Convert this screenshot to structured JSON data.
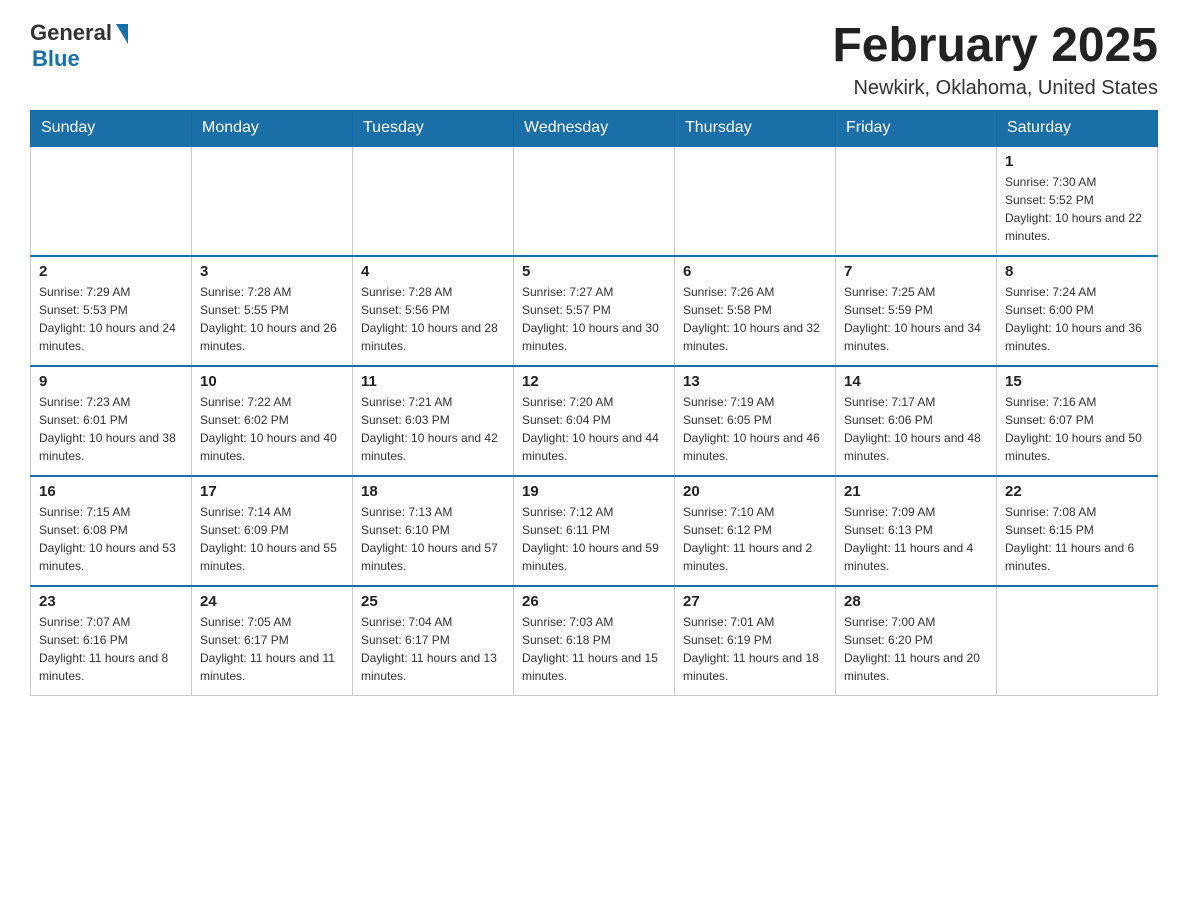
{
  "header": {
    "logo_general": "General",
    "logo_blue": "Blue",
    "title": "February 2025",
    "location": "Newkirk, Oklahoma, United States"
  },
  "weekdays": [
    "Sunday",
    "Monday",
    "Tuesday",
    "Wednesday",
    "Thursday",
    "Friday",
    "Saturday"
  ],
  "weeks": [
    [
      {
        "day": "",
        "sunrise": "",
        "sunset": "",
        "daylight": ""
      },
      {
        "day": "",
        "sunrise": "",
        "sunset": "",
        "daylight": ""
      },
      {
        "day": "",
        "sunrise": "",
        "sunset": "",
        "daylight": ""
      },
      {
        "day": "",
        "sunrise": "",
        "sunset": "",
        "daylight": ""
      },
      {
        "day": "",
        "sunrise": "",
        "sunset": "",
        "daylight": ""
      },
      {
        "day": "",
        "sunrise": "",
        "sunset": "",
        "daylight": ""
      },
      {
        "day": "1",
        "sunrise": "Sunrise: 7:30 AM",
        "sunset": "Sunset: 5:52 PM",
        "daylight": "Daylight: 10 hours and 22 minutes."
      }
    ],
    [
      {
        "day": "2",
        "sunrise": "Sunrise: 7:29 AM",
        "sunset": "Sunset: 5:53 PM",
        "daylight": "Daylight: 10 hours and 24 minutes."
      },
      {
        "day": "3",
        "sunrise": "Sunrise: 7:28 AM",
        "sunset": "Sunset: 5:55 PM",
        "daylight": "Daylight: 10 hours and 26 minutes."
      },
      {
        "day": "4",
        "sunrise": "Sunrise: 7:28 AM",
        "sunset": "Sunset: 5:56 PM",
        "daylight": "Daylight: 10 hours and 28 minutes."
      },
      {
        "day": "5",
        "sunrise": "Sunrise: 7:27 AM",
        "sunset": "Sunset: 5:57 PM",
        "daylight": "Daylight: 10 hours and 30 minutes."
      },
      {
        "day": "6",
        "sunrise": "Sunrise: 7:26 AM",
        "sunset": "Sunset: 5:58 PM",
        "daylight": "Daylight: 10 hours and 32 minutes."
      },
      {
        "day": "7",
        "sunrise": "Sunrise: 7:25 AM",
        "sunset": "Sunset: 5:59 PM",
        "daylight": "Daylight: 10 hours and 34 minutes."
      },
      {
        "day": "8",
        "sunrise": "Sunrise: 7:24 AM",
        "sunset": "Sunset: 6:00 PM",
        "daylight": "Daylight: 10 hours and 36 minutes."
      }
    ],
    [
      {
        "day": "9",
        "sunrise": "Sunrise: 7:23 AM",
        "sunset": "Sunset: 6:01 PM",
        "daylight": "Daylight: 10 hours and 38 minutes."
      },
      {
        "day": "10",
        "sunrise": "Sunrise: 7:22 AM",
        "sunset": "Sunset: 6:02 PM",
        "daylight": "Daylight: 10 hours and 40 minutes."
      },
      {
        "day": "11",
        "sunrise": "Sunrise: 7:21 AM",
        "sunset": "Sunset: 6:03 PM",
        "daylight": "Daylight: 10 hours and 42 minutes."
      },
      {
        "day": "12",
        "sunrise": "Sunrise: 7:20 AM",
        "sunset": "Sunset: 6:04 PM",
        "daylight": "Daylight: 10 hours and 44 minutes."
      },
      {
        "day": "13",
        "sunrise": "Sunrise: 7:19 AM",
        "sunset": "Sunset: 6:05 PM",
        "daylight": "Daylight: 10 hours and 46 minutes."
      },
      {
        "day": "14",
        "sunrise": "Sunrise: 7:17 AM",
        "sunset": "Sunset: 6:06 PM",
        "daylight": "Daylight: 10 hours and 48 minutes."
      },
      {
        "day": "15",
        "sunrise": "Sunrise: 7:16 AM",
        "sunset": "Sunset: 6:07 PM",
        "daylight": "Daylight: 10 hours and 50 minutes."
      }
    ],
    [
      {
        "day": "16",
        "sunrise": "Sunrise: 7:15 AM",
        "sunset": "Sunset: 6:08 PM",
        "daylight": "Daylight: 10 hours and 53 minutes."
      },
      {
        "day": "17",
        "sunrise": "Sunrise: 7:14 AM",
        "sunset": "Sunset: 6:09 PM",
        "daylight": "Daylight: 10 hours and 55 minutes."
      },
      {
        "day": "18",
        "sunrise": "Sunrise: 7:13 AM",
        "sunset": "Sunset: 6:10 PM",
        "daylight": "Daylight: 10 hours and 57 minutes."
      },
      {
        "day": "19",
        "sunrise": "Sunrise: 7:12 AM",
        "sunset": "Sunset: 6:11 PM",
        "daylight": "Daylight: 10 hours and 59 minutes."
      },
      {
        "day": "20",
        "sunrise": "Sunrise: 7:10 AM",
        "sunset": "Sunset: 6:12 PM",
        "daylight": "Daylight: 11 hours and 2 minutes."
      },
      {
        "day": "21",
        "sunrise": "Sunrise: 7:09 AM",
        "sunset": "Sunset: 6:13 PM",
        "daylight": "Daylight: 11 hours and 4 minutes."
      },
      {
        "day": "22",
        "sunrise": "Sunrise: 7:08 AM",
        "sunset": "Sunset: 6:15 PM",
        "daylight": "Daylight: 11 hours and 6 minutes."
      }
    ],
    [
      {
        "day": "23",
        "sunrise": "Sunrise: 7:07 AM",
        "sunset": "Sunset: 6:16 PM",
        "daylight": "Daylight: 11 hours and 8 minutes."
      },
      {
        "day": "24",
        "sunrise": "Sunrise: 7:05 AM",
        "sunset": "Sunset: 6:17 PM",
        "daylight": "Daylight: 11 hours and 11 minutes."
      },
      {
        "day": "25",
        "sunrise": "Sunrise: 7:04 AM",
        "sunset": "Sunset: 6:17 PM",
        "daylight": "Daylight: 11 hours and 13 minutes."
      },
      {
        "day": "26",
        "sunrise": "Sunrise: 7:03 AM",
        "sunset": "Sunset: 6:18 PM",
        "daylight": "Daylight: 11 hours and 15 minutes."
      },
      {
        "day": "27",
        "sunrise": "Sunrise: 7:01 AM",
        "sunset": "Sunset: 6:19 PM",
        "daylight": "Daylight: 11 hours and 18 minutes."
      },
      {
        "day": "28",
        "sunrise": "Sunrise: 7:00 AM",
        "sunset": "Sunset: 6:20 PM",
        "daylight": "Daylight: 11 hours and 20 minutes."
      },
      {
        "day": "",
        "sunrise": "",
        "sunset": "",
        "daylight": ""
      }
    ]
  ]
}
